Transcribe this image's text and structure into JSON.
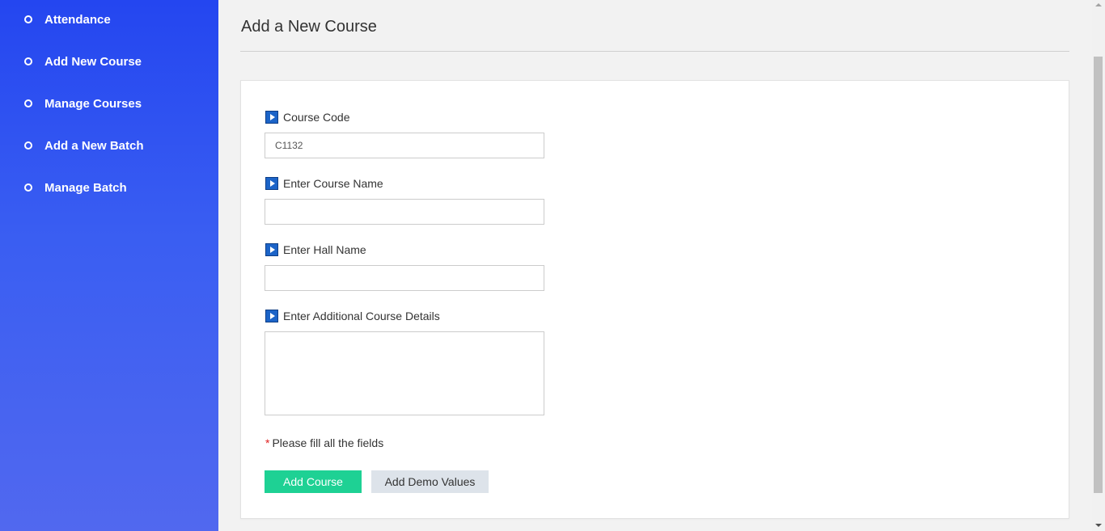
{
  "sidebar": {
    "items": [
      {
        "label": "Attendance"
      },
      {
        "label": "Add New Course"
      },
      {
        "label": "Manage Courses"
      },
      {
        "label": "Add a New Batch"
      },
      {
        "label": "Manage Batch"
      }
    ]
  },
  "main": {
    "page_title": "Add a New Course",
    "form": {
      "course_code": {
        "label": "Course Code",
        "value": "C1132"
      },
      "course_name": {
        "label": "Enter Course Name",
        "value": ""
      },
      "hall_name": {
        "label": "Enter Hall Name",
        "value": ""
      },
      "details": {
        "label": "Enter Additional Course Details",
        "value": ""
      },
      "required_star": "*",
      "required_note": "Please fill all the fields",
      "submit_label": "Add Course",
      "demo_label": "Add Demo Values"
    }
  },
  "colors": {
    "sidebar_top": "#2446f0",
    "sidebar_bottom": "#5168ef",
    "primary_button": "#1ed194",
    "secondary_button": "#dde3ea",
    "label_icon": "#1c64c8",
    "required_star": "#e02020"
  },
  "icons": {
    "nav_bullet": "circle-outline-icon",
    "label_marker": "play-arrow-icon"
  }
}
